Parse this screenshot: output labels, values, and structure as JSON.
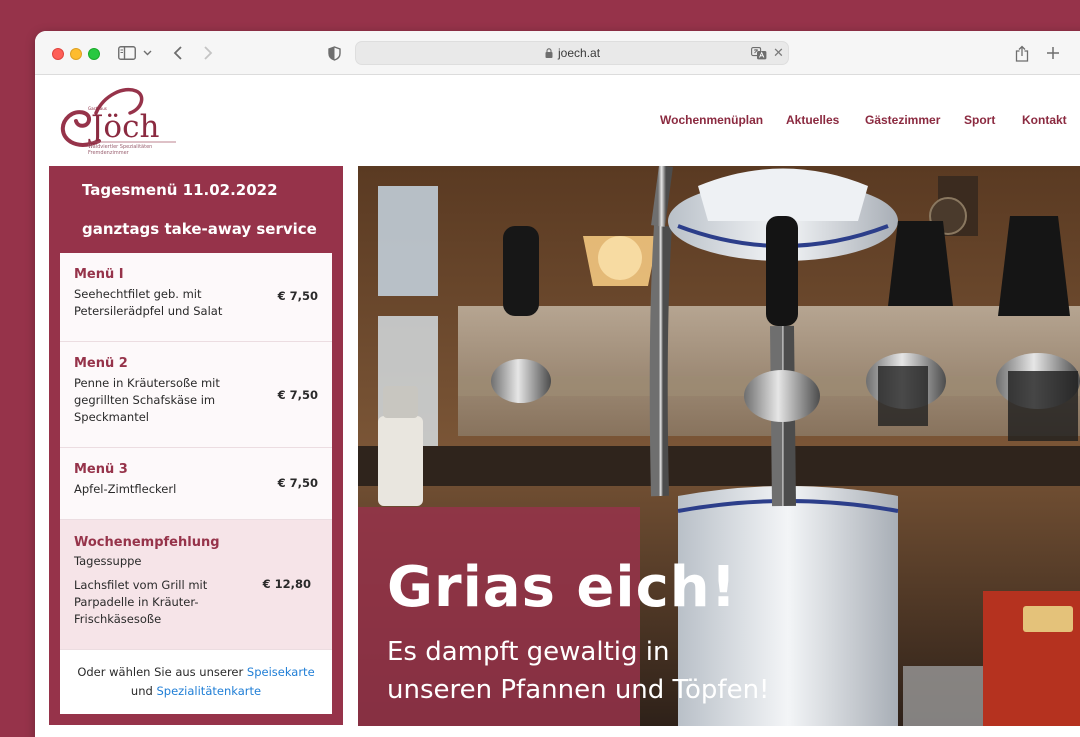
{
  "browser": {
    "url": "joech.at"
  },
  "site": {
    "logo": {
      "small_text": "Gasthaus",
      "wordmark": "Jöch",
      "tagline_1": "Waldviertler Spezialitäten",
      "tagline_2": "Fremdenzimmer"
    },
    "nav": [
      "Wochenmenüplan",
      "Aktuelles",
      "Gästezimmer",
      "Sport",
      "Kontakt"
    ]
  },
  "menu_panel": {
    "title_date": "Tagesmenü 11.02.2022",
    "title_service": "ganztags take-away service",
    "items": [
      {
        "name": "Menü I",
        "lines": [
          "Seehechtfilet geb. mit",
          "Petersilerädpfel und Salat"
        ],
        "price": "€ 7,50"
      },
      {
        "name": "Menü 2",
        "lines": [
          "Penne in Kräutersoße mit",
          "gegrillten Schafskäse im",
          "Speckmantel"
        ],
        "price": "€ 7,50"
      },
      {
        "name": "Menü 3",
        "lines": [
          "Apfel-Zimtfleckerl"
        ],
        "price": "€ 7,50"
      }
    ],
    "weekly": {
      "name": "Wochenempfehlung",
      "soup": "Tagessuppe",
      "lines": [
        "Lachsfilet vom Grill mit",
        "Parpadelle in Kräuter-",
        "Frischkäsesoße"
      ],
      "price": "€ 12,80"
    },
    "footer": {
      "text_1": "Oder wählen Sie aus unserer",
      "link_1": "Speisekarte",
      "text_2": "und",
      "link_2": "Spezialitätenkarte"
    }
  },
  "hero": {
    "title": "Grias eich!",
    "subtitle_1": "Es dampft gewaltig in",
    "subtitle_2": "unseren Pfannen und Töpfen!"
  },
  "colors": {
    "brand": "#96334a",
    "link": "#1f7ed6"
  }
}
